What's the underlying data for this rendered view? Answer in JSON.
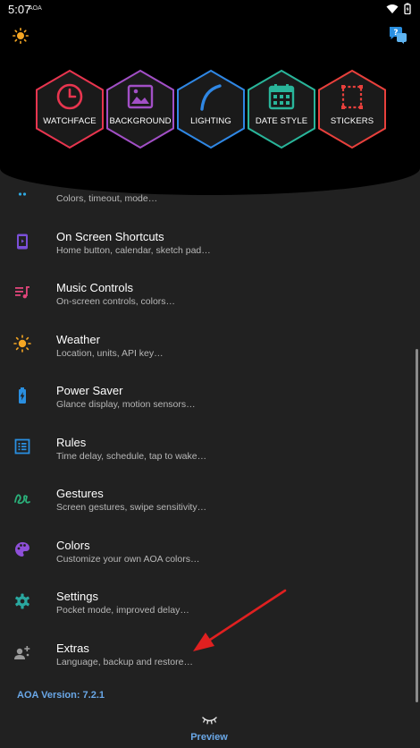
{
  "status_bar": {
    "time": "5:07",
    "app_tag": "AOA"
  },
  "header": {
    "tiles": [
      {
        "label": "WATCHFACE",
        "icon": "clock-icon",
        "color": "#e8354f"
      },
      {
        "label": "BACKGROUND",
        "icon": "image-icon",
        "color": "#a24fc6"
      },
      {
        "label": "LIGHTING",
        "icon": "lighting-arc-icon",
        "color": "#2f87e4"
      },
      {
        "label": "DATE STYLE",
        "icon": "calendar-icon",
        "color": "#29b59a"
      },
      {
        "label": "STICKERS",
        "icon": "sticker-frame-icon",
        "color": "#e8403c"
      }
    ]
  },
  "menu": {
    "items": [
      {
        "title": "",
        "subtitle": "Colors, timeout, mode…",
        "icon": "dots-icon",
        "color": "#2fa8e0"
      },
      {
        "title": "On Screen Shortcuts",
        "subtitle": "Home button, calendar, sketch pad…",
        "icon": "shortcut-icon",
        "color": "#7a4fd8"
      },
      {
        "title": "Music Controls",
        "subtitle": "On-screen controls, colors…",
        "icon": "music-icon",
        "color": "#e0457a"
      },
      {
        "title": "Weather",
        "subtitle": "Location, units, API key…",
        "icon": "sun-icon",
        "color": "#f5a623"
      },
      {
        "title": "Power Saver",
        "subtitle": "Glance display, motion sensors…",
        "icon": "battery-icon",
        "color": "#2a8fe0"
      },
      {
        "title": "Rules",
        "subtitle": "Time delay, schedule, tap to wake…",
        "icon": "list-icon",
        "color": "#2a8fe0"
      },
      {
        "title": "Gestures",
        "subtitle": "Screen gestures, swipe sensitivity…",
        "icon": "gesture-icon",
        "color": "#2bb07a"
      },
      {
        "title": "Colors",
        "subtitle": "Customize your own AOA colors…",
        "icon": "palette-icon",
        "color": "#8e4fd8"
      },
      {
        "title": "Settings",
        "subtitle": "Pocket mode, improved delay…",
        "icon": "gear-icon",
        "color": "#2aa8a0"
      },
      {
        "title": "Extras",
        "subtitle": "Language, backup and restore…",
        "icon": "extras-icon",
        "color": "#9a9a9a"
      }
    ]
  },
  "footer": {
    "version": "AOA Version: 7.2.1",
    "preview_label": "Preview"
  }
}
